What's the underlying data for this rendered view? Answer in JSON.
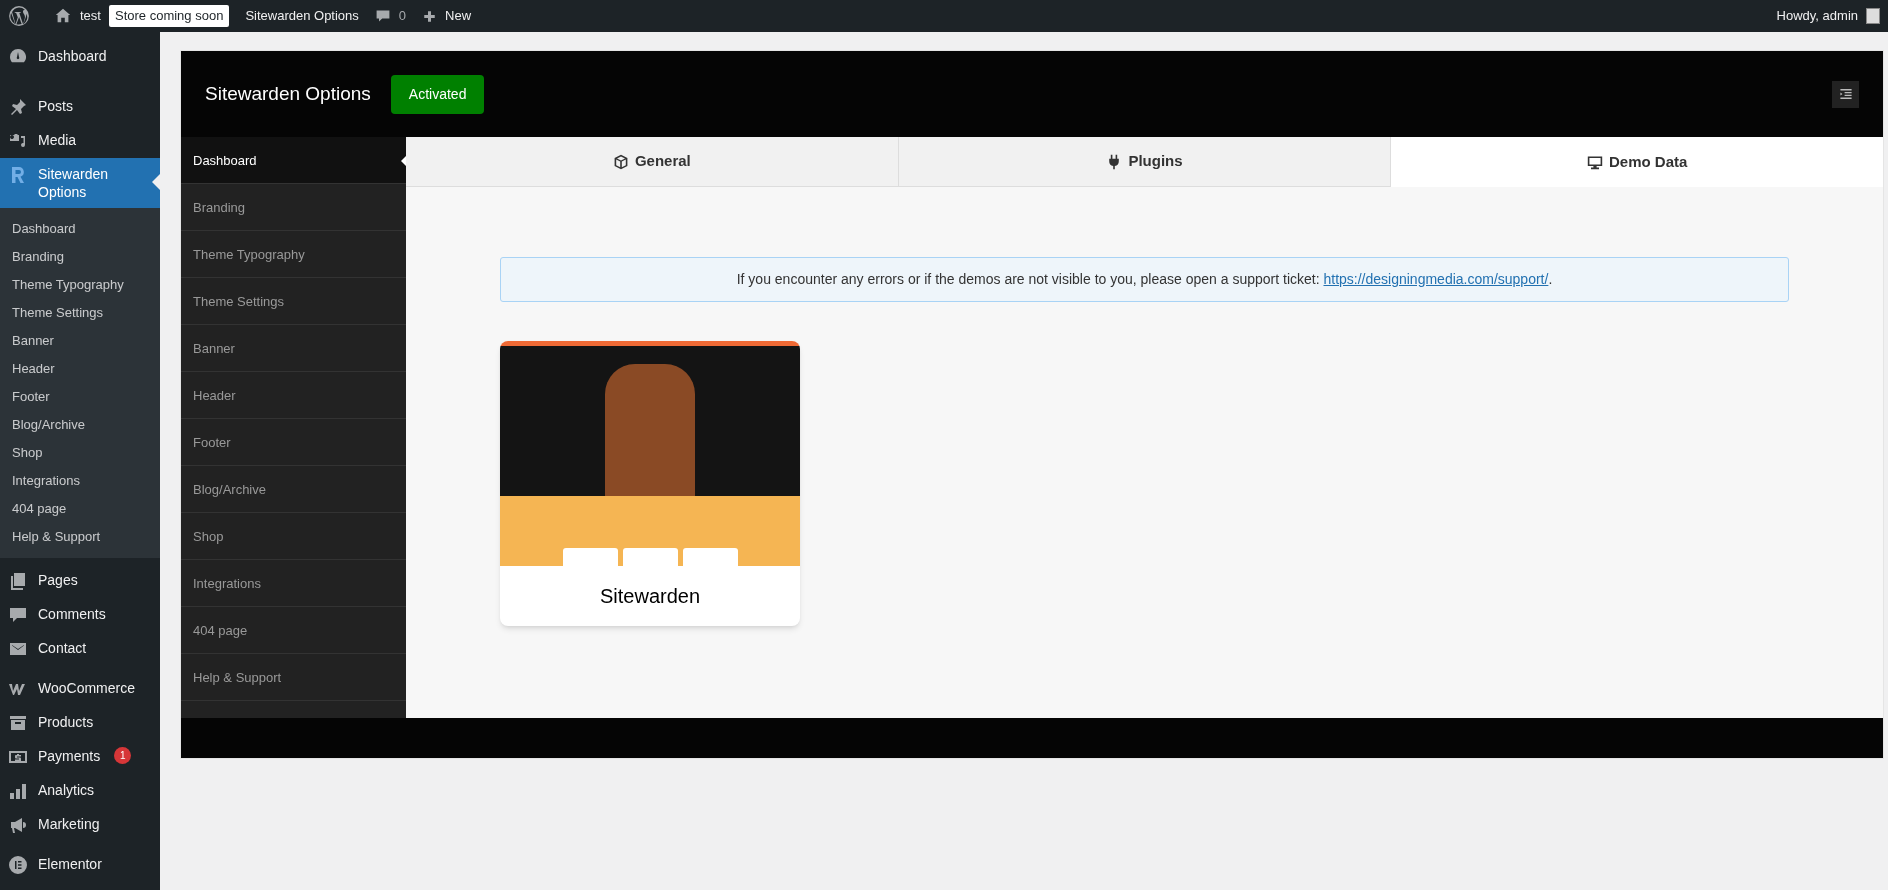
{
  "admin_bar": {
    "site": "test",
    "badge": "Store coming soon",
    "options": "Sitewarden Options",
    "comments": "0",
    "new": "New",
    "howdy": "Howdy, admin"
  },
  "sidebar": {
    "items": [
      {
        "kind": "dashboard",
        "label": "Dashboard",
        "selected": false
      },
      {
        "kind": "pin",
        "label": "Posts",
        "selected": false
      },
      {
        "kind": "media",
        "label": "Media",
        "selected": false
      },
      {
        "kind": "r",
        "label": "Sitewarden Options",
        "selected": true,
        "children": [
          {
            "label": "Dashboard",
            "selected": false
          },
          {
            "label": "Branding",
            "selected": false
          },
          {
            "label": "Theme Typography",
            "selected": false
          },
          {
            "label": "Theme Settings",
            "selected": false
          },
          {
            "label": "Banner",
            "selected": false
          },
          {
            "label": "Header",
            "selected": false
          },
          {
            "label": "Footer",
            "selected": false
          },
          {
            "label": "Blog/Archive",
            "selected": false
          },
          {
            "label": "Shop",
            "selected": false
          },
          {
            "label": "Integrations",
            "selected": false
          },
          {
            "label": "404 page",
            "selected": false
          },
          {
            "label": "Help & Support",
            "selected": false
          }
        ]
      },
      {
        "kind": "pages",
        "label": "Pages",
        "selected": false
      },
      {
        "kind": "comment",
        "label": "Comments",
        "selected": false
      },
      {
        "kind": "mail",
        "label": "Contact",
        "selected": false
      },
      {
        "kind": "woo",
        "label": "WooCommerce",
        "selected": false
      },
      {
        "kind": "box",
        "label": "Products",
        "selected": false
      },
      {
        "kind": "dollar",
        "label": "Payments",
        "selected": false,
        "badge": "1"
      },
      {
        "kind": "bars",
        "label": "Analytics",
        "selected": false
      },
      {
        "kind": "megaphone",
        "label": "Marketing",
        "selected": false
      },
      {
        "kind": "elementor",
        "label": "Elementor",
        "selected": false
      }
    ]
  },
  "panel": {
    "title": "Sitewarden Options",
    "status": "Activated",
    "nav": [
      {
        "label": "Dashboard",
        "selected": true
      },
      {
        "label": "Branding",
        "selected": false
      },
      {
        "label": "Theme Typography",
        "selected": false
      },
      {
        "label": "Theme Settings",
        "selected": false
      },
      {
        "label": "Banner",
        "selected": false
      },
      {
        "label": "Header",
        "selected": false
      },
      {
        "label": "Footer",
        "selected": false
      },
      {
        "label": "Blog/Archive",
        "selected": false
      },
      {
        "label": "Shop",
        "selected": false
      },
      {
        "label": "Integrations",
        "selected": false
      },
      {
        "label": "404 page",
        "selected": false
      },
      {
        "label": "Help & Support",
        "selected": false
      }
    ],
    "tabs": [
      {
        "kind": "cube",
        "label": "General",
        "selected": false
      },
      {
        "kind": "plug",
        "label": "Plugins",
        "selected": false
      },
      {
        "kind": "monitor",
        "label": "Demo Data",
        "selected": true
      }
    ],
    "notice": {
      "text": "If you encounter any errors or if the demos are not visible to you, please open a support ticket: ",
      "link": "https://designingmedia.com/support/",
      "after": "."
    },
    "demos": [
      {
        "name": "Sitewarden"
      }
    ]
  }
}
